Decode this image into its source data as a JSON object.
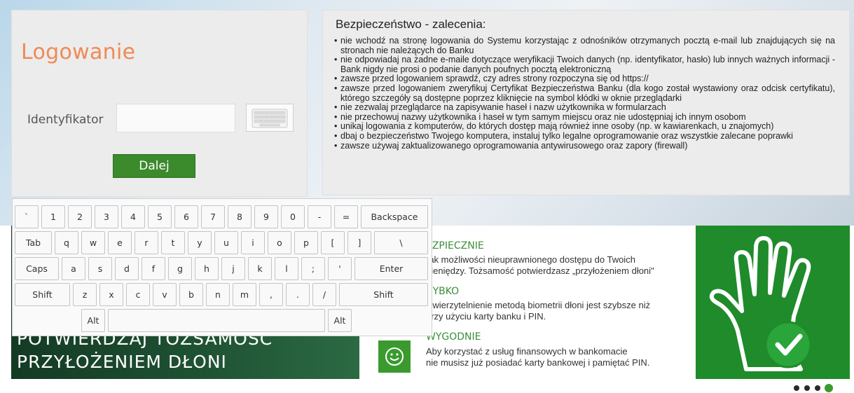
{
  "login": {
    "title": "Logowanie",
    "identifier_label": "Identyfikator",
    "identifier_value": "",
    "next_button": "Dalej"
  },
  "security": {
    "title": "Bezpieczeństwo - zalecenia:",
    "items": [
      "nie wchodź na stronę logowania do Systemu korzystając z odnośników otrzymanych pocztą e-mail lub znajdujących się na stronach nie należących do Banku",
      "nie odpowiadaj na żadne e-maile dotyczące weryfikacji Twoich danych (np. identyfikator, hasło) lub innych ważnych informacji - Bank nigdy nie prosi o podanie danych poufnych pocztą elektroniczną",
      "zawsze przed logowaniem sprawdź, czy adres strony rozpoczyna się od https://",
      "zawsze przed logowaniem zweryfikuj Certyfikat Bezpieczeństwa Banku (dla kogo został wystawiony oraz odcisk certyfikatu), którego szczegóły są dostępne poprzez kliknięcie na symbol kłódki w oknie przeglądarki",
      "nie zezwalaj przeglądarce na zapisywanie haseł i nazw użytkownika w formularzach",
      "nie przechowuj nazwy użytkownika i haseł w tym samym miejscu oraz nie udostępniaj ich innym osobom",
      "unikaj logowania z komputerów, do których dostęp mają również inne osoby (np. w kawiarenkach, u znajomych)",
      "dbaj o bezpieczeństwo Twojego komputera, instaluj tylko legalne oprogramowanie oraz wszystkie zalecane poprawki",
      "zawsze używaj zaktualizowanego oprogramowania antywirusowego oraz zapory (firewall)"
    ]
  },
  "promo": {
    "headline_line1": "POTWIERDZAJ TOŻSAMOŚĆ",
    "headline_line2": "PRZYŁOŻENIEM DŁONI",
    "features": [
      {
        "title": "EZPIECZNIE",
        "text": "rak możliwości nieuprawnionego dostępu do Twoich\npieniędzy. Tożsamość potwierdzasz „przyłożeniem dłoni\""
      },
      {
        "title": "ZYBKO",
        "text": "Uwierzytelnienie metodą biometrii dłoni jest szybsze niż\nprzy użyciu karty banku i PIN."
      },
      {
        "title": "WYGODNIE",
        "text": "Aby korzystać z usług finansowych w bankomacie\nnie musisz już posiadać karty bankowej i pamiętać PIN."
      }
    ],
    "slider_dots": 4,
    "active_dot": 3
  },
  "virtual_keyboard": {
    "rows": [
      [
        "`",
        "1",
        "2",
        "3",
        "4",
        "5",
        "6",
        "7",
        "8",
        "9",
        "0",
        "-",
        "=",
        "Backspace"
      ],
      [
        "Tab",
        "q",
        "w",
        "e",
        "r",
        "t",
        "y",
        "u",
        "i",
        "o",
        "p",
        "[",
        "]",
        "\\"
      ],
      [
        "Caps",
        "a",
        "s",
        "d",
        "f",
        "g",
        "h",
        "j",
        "k",
        "l",
        ";",
        "'",
        "Enter"
      ],
      [
        "Shift",
        "z",
        "x",
        "c",
        "v",
        "b",
        "n",
        "m",
        ",",
        ".",
        "/",
        "Shift"
      ],
      [
        "Alt",
        "",
        "Alt"
      ]
    ]
  },
  "colors": {
    "login_title": "#ef8a55",
    "button_green": "#3b8a2c",
    "feature_green": "#3a8f3a",
    "hand_panel": "#1f8b2b"
  }
}
